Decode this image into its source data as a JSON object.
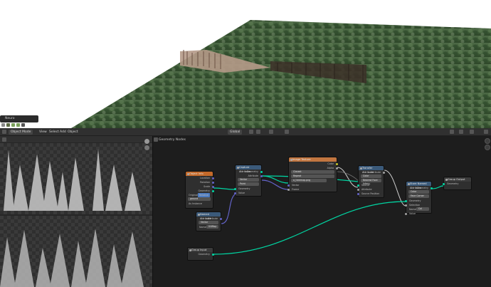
{
  "viewport": {
    "panel_label": "Neuro"
  },
  "header": {
    "mode": "Object Mode",
    "menus": [
      "View",
      "Select",
      "Add",
      "Object"
    ],
    "transform_orientation": "Global"
  },
  "node_editor": {
    "tree_name": "Geometry Nodes",
    "nodes": {
      "group_input": {
        "title": "Object Info",
        "rows": [
          "Location",
          "Rotation",
          "Scale",
          "Geometry",
          "Original",
          "Relative",
          "As Instance"
        ],
        "object_value": "ground"
      },
      "capture": {
        "title": "Capture Attribute",
        "outputs": [
          "Geometry",
          "Attribute"
        ],
        "fields": [
          "Vector",
          "Point"
        ],
        "inputs": [
          "Geometry",
          "Value"
        ]
      },
      "named_attr": {
        "title": "Named Attribute",
        "output": "Attribute",
        "type": "Vector",
        "name_label": "Name",
        "name_value": "UVMap"
      },
      "image_texture": {
        "title": "Image Texture",
        "outputs": [
          "Color",
          "Alpha"
        ],
        "fields": [
          "Closest",
          "Repeat"
        ],
        "image_name": "a_treemap.png",
        "inputs": [
          "Vector",
          "Frame"
        ]
      },
      "transfer": {
        "title": "Transfer Attribute",
        "output": "Attribute",
        "fields": [
          "Color",
          "Nearest Face Interp."
        ],
        "inputs": [
          "Source",
          "Attribute",
          "Source Position"
        ]
      },
      "store": {
        "title": "Store Named Attribute",
        "output": "Geometry",
        "fields": [
          "Color",
          "Face Corner"
        ],
        "inputs": [
          "Geometry",
          "Selection"
        ],
        "name_label": "Name",
        "name_value": "Col",
        "value_label": "Value"
      },
      "group_output": {
        "title": "Group Output",
        "input": "Geometry"
      },
      "group_input2": {
        "title": "Group Input",
        "output": "Geometry"
      }
    }
  }
}
